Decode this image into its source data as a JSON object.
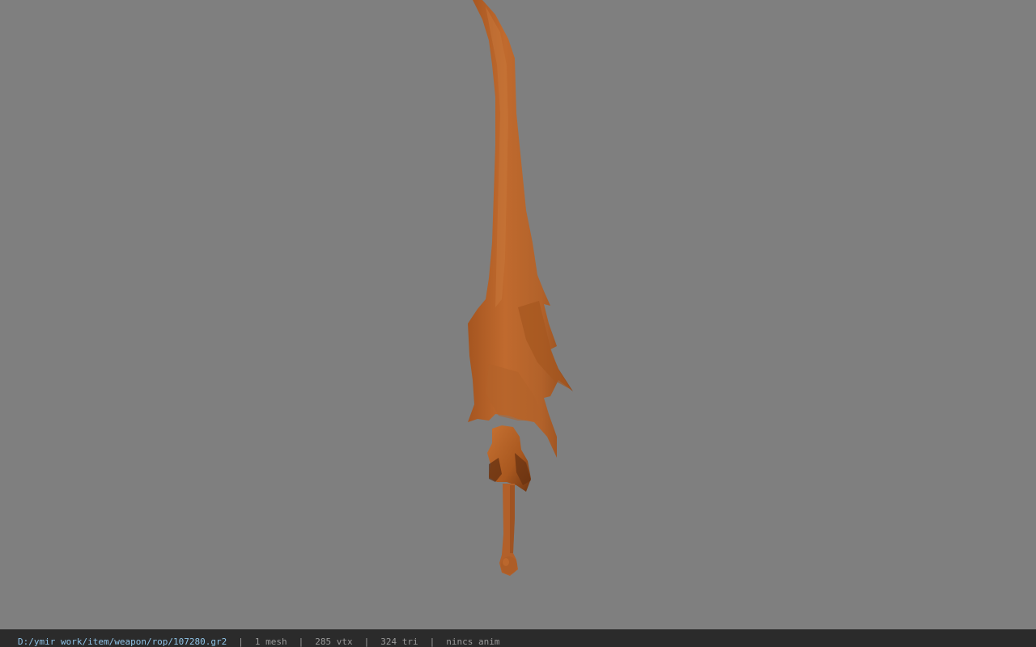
{
  "viewport": {
    "background_color": "#7f7f7f",
    "model": {
      "name": "sword-model",
      "color": "#b5652a"
    }
  },
  "status_bar": {
    "file_path": "D:/ymir work/item/weapon/rop/107280.gr2",
    "separator": "|",
    "mesh_count": "1 mesh",
    "vertex_count": "285 vtx",
    "triangle_count": "324 tri",
    "animation_status": "nincs anim",
    "path_color": "#8fc4e8"
  }
}
